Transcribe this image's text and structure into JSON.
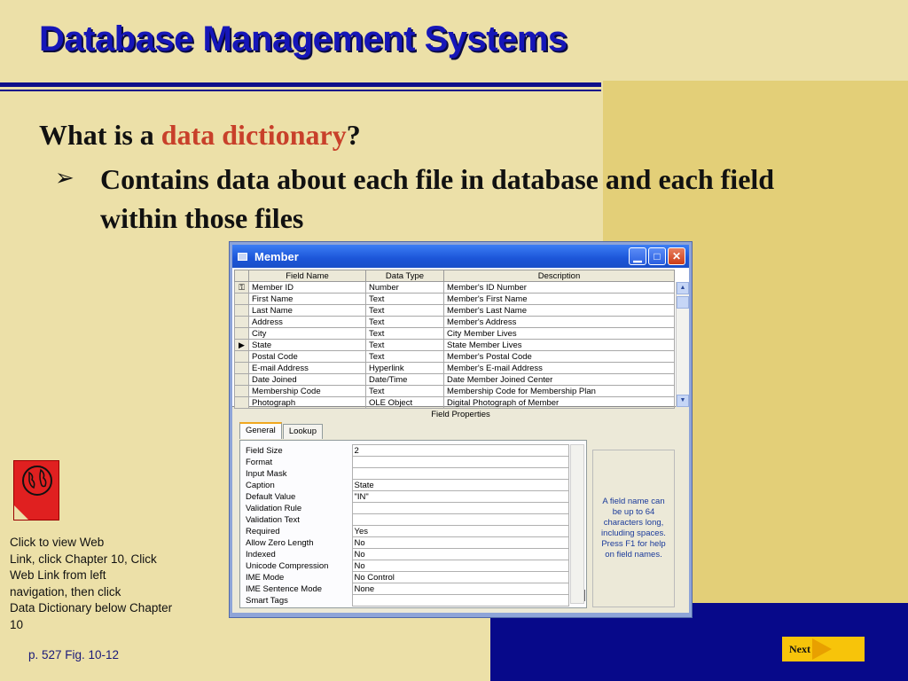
{
  "slide": {
    "title": "Database Management Systems",
    "question_prefix": "What is a ",
    "question_highlight": "data dictionary",
    "question_suffix": "?",
    "bullet_marker": "➢",
    "bullet_text": "Contains data about each file in database and each field within those files",
    "colors": {
      "title": "#1616b8",
      "highlight": "#c8402a",
      "background": "#ece0a8",
      "navy": "#07098a",
      "gold_panel": "#e3cf78"
    }
  },
  "window": {
    "title": "Member",
    "controls": {
      "minimize": "minimize-icon",
      "maximize": "maximize-icon",
      "close": "close-icon"
    }
  },
  "design_grid": {
    "columns": [
      "Field Name",
      "Data Type",
      "Description"
    ],
    "rows": [
      {
        "marker": "key",
        "name": "Member ID",
        "type": "Number",
        "desc": "Member's ID Number"
      },
      {
        "marker": "",
        "name": "First Name",
        "type": "Text",
        "desc": "Member's First Name"
      },
      {
        "marker": "",
        "name": "Last Name",
        "type": "Text",
        "desc": "Member's Last Name"
      },
      {
        "marker": "",
        "name": "Address",
        "type": "Text",
        "desc": "Member's Address"
      },
      {
        "marker": "",
        "name": "City",
        "type": "Text",
        "desc": "City Member Lives"
      },
      {
        "marker": "current",
        "name": "State",
        "type": "Text",
        "desc": "State Member Lives"
      },
      {
        "marker": "",
        "name": "Postal Code",
        "type": "Text",
        "desc": "Member's Postal Code"
      },
      {
        "marker": "",
        "name": "E-mail Address",
        "type": "Hyperlink",
        "desc": "Member's E-mail Address"
      },
      {
        "marker": "",
        "name": "Date Joined",
        "type": "Date/Time",
        "desc": "Date Member Joined Center"
      },
      {
        "marker": "",
        "name": "Membership Code",
        "type": "Text",
        "desc": "Membership Code for Membership Plan"
      },
      {
        "marker": "",
        "name": "Photograph",
        "type": "OLE Object",
        "desc": "Digital Photograph of Member"
      }
    ]
  },
  "field_properties": {
    "label": "Field Properties",
    "tabs": [
      "General",
      "Lookup"
    ],
    "active_tab": "General",
    "properties": [
      {
        "name": "Field Size",
        "value": "2"
      },
      {
        "name": "Format",
        "value": ""
      },
      {
        "name": "Input Mask",
        "value": ""
      },
      {
        "name": "Caption",
        "value": "State"
      },
      {
        "name": "Default Value",
        "value": "\"IN\""
      },
      {
        "name": "Validation Rule",
        "value": ""
      },
      {
        "name": "Validation Text",
        "value": ""
      },
      {
        "name": "Required",
        "value": "Yes"
      },
      {
        "name": "Allow Zero Length",
        "value": "No"
      },
      {
        "name": "Indexed",
        "value": "No"
      },
      {
        "name": "Unicode Compression",
        "value": "No"
      },
      {
        "name": "IME Mode",
        "value": "No Control"
      },
      {
        "name": "IME Sentence Mode",
        "value": "None"
      },
      {
        "name": "Smart Tags",
        "value": ""
      }
    ],
    "build_button": "...",
    "help_text": "A field name can be up to 64 characters long, including spaces. Press F1 for help on field names."
  },
  "weblink": {
    "icon": "globe-weblink-icon",
    "caption_lines": [
      "Click to view Web",
      "Link, click Chapter 10, Click",
      "Web Link from left",
      "navigation, then click",
      "Data Dictionary below Chapter",
      "10"
    ]
  },
  "footer": {
    "page_ref": "p. 527 Fig. 10-12",
    "next_label": "Next"
  }
}
